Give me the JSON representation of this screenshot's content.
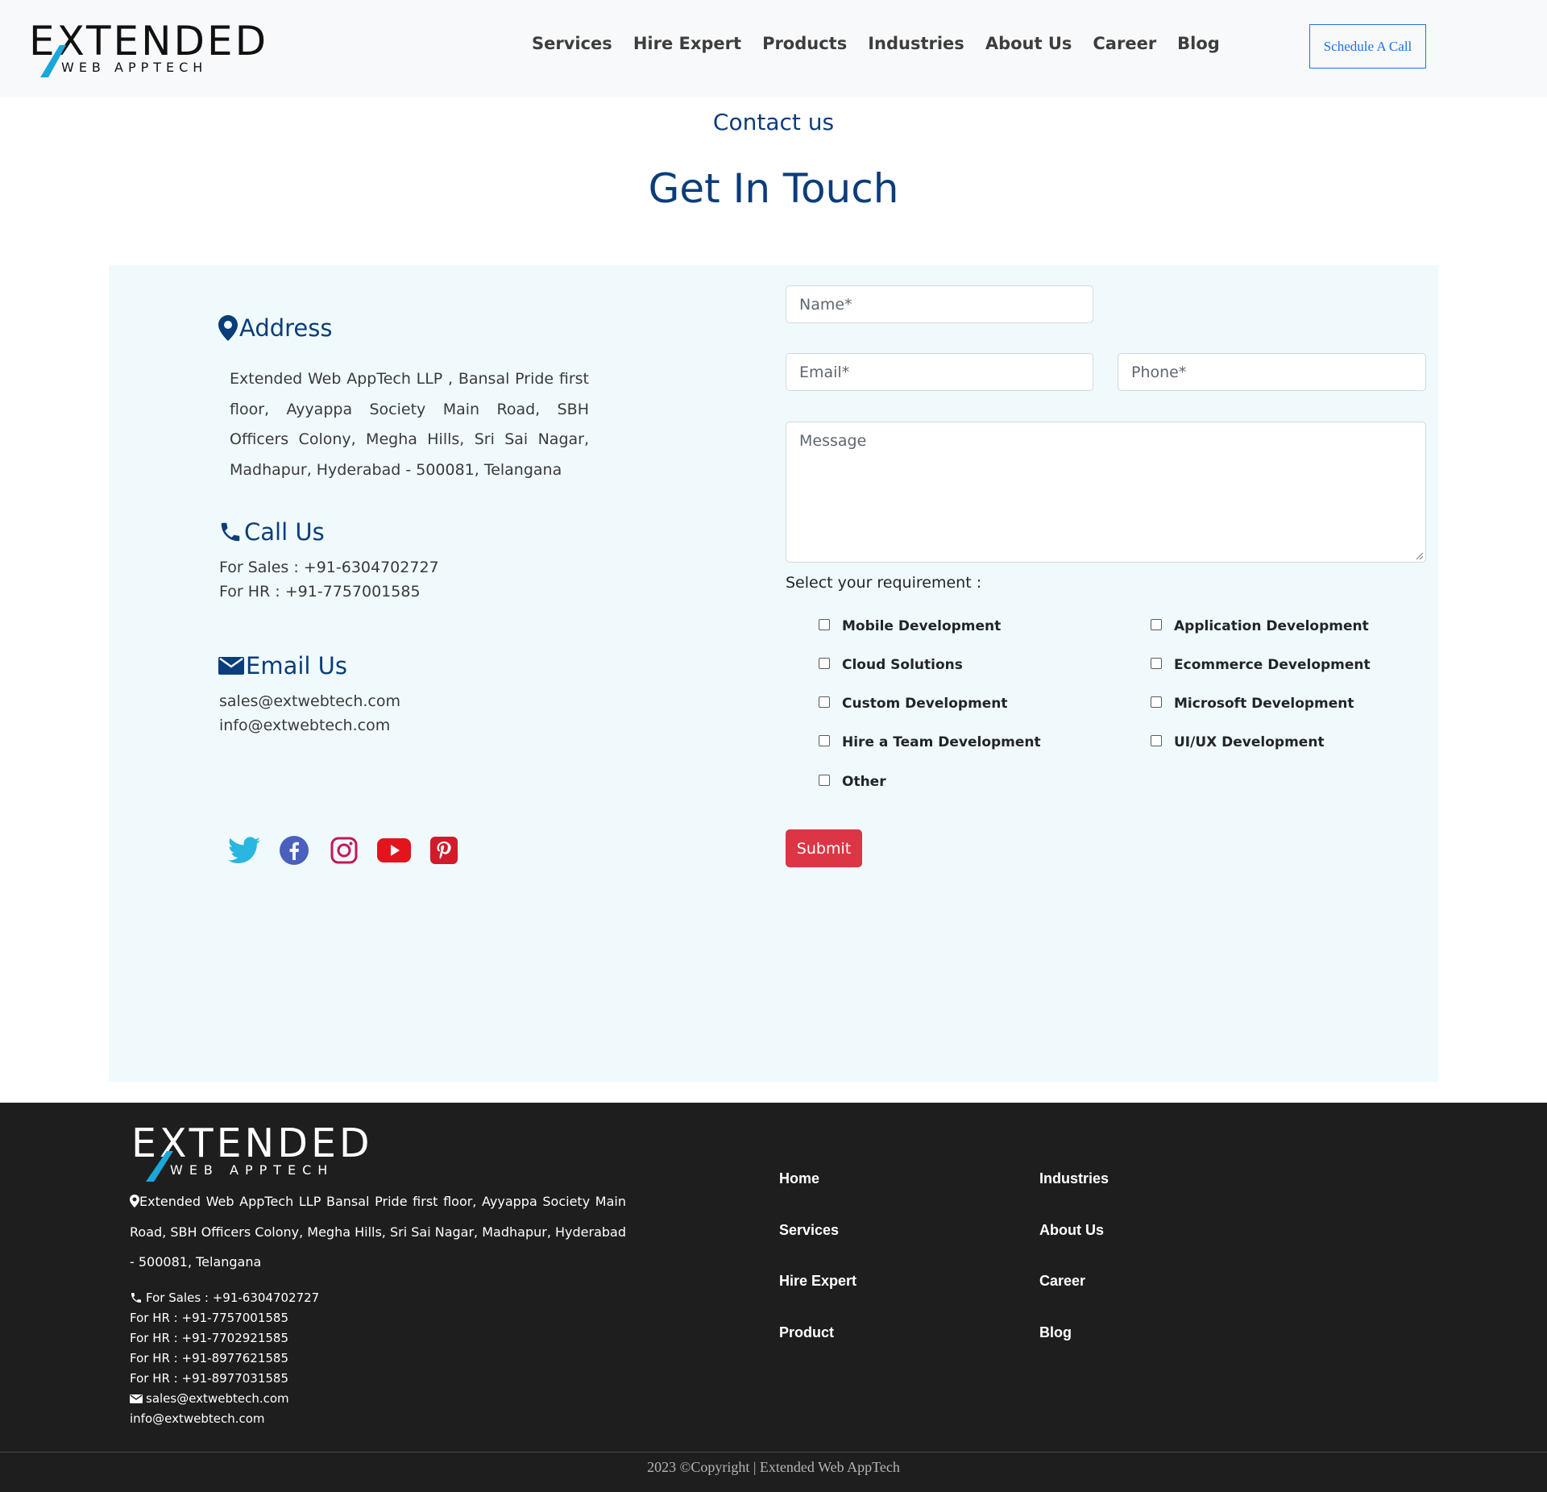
{
  "header": {
    "logo_main": "EXTENDED",
    "logo_sub": "WEB APPTECH",
    "nav": [
      "Services",
      "Hire Expert",
      "Products",
      "Industries",
      "About Us",
      "Career",
      "Blog"
    ],
    "schedule_label": "Schedule A Call"
  },
  "hero": {
    "eyebrow": "Contact us",
    "title": "Get In Touch"
  },
  "contact": {
    "address_heading": "Address",
    "address": "Extended Web AppTech LLP , Bansal Pride first floor, Ayyappa Society Main Road, SBH Officers Colony, Megha Hills, Sri Sai Nagar, Madhapur, Hyderabad - 500081, Telangana",
    "call_heading": "Call Us",
    "sales_phone": "For Sales : +91-6304702727",
    "hr_phone": "For HR : +91-7757001585",
    "email_heading": "Email Us",
    "email_sales": "sales@extwebtech.com",
    "email_info": "info@extwebtech.com",
    "social": [
      "twitter-icon",
      "facebook-icon",
      "instagram-icon",
      "youtube-icon",
      "pinterest-icon"
    ]
  },
  "form": {
    "name_placeholder": "Name*",
    "email_placeholder": "Email*",
    "phone_placeholder": "Phone*",
    "message_placeholder": "Message",
    "requirement_label": "Select your requirement :",
    "options": [
      "Mobile Development",
      "Application Development",
      "Cloud Solutions",
      "Ecommerce Development",
      "Custom Development",
      "Microsoft Development",
      "Hire a Team Development",
      "UI/UX Development",
      "Other"
    ],
    "submit_label": "Submit"
  },
  "footer": {
    "logo_main": "EXTENDED",
    "logo_sub": "WEB APPTECH",
    "address": "Extended Web AppTech LLP Bansal Pride first floor, Ayyappa Society Main Road, SBH Officers Colony, Megha Hills, Sri Sai Nagar, Madhapur, Hyderabad - 500081, Telangana",
    "sales_phone": "For Sales : +91-6304702727",
    "hr_phones": [
      "For HR : +91-7757001585",
      "For HR : +91-7702921585",
      "For HR : +91-8977621585",
      "For HR : +91-8977031585"
    ],
    "email_sales": "sales@extwebtech.com",
    "email_info": "info@extwebtech.com",
    "links_col1": [
      "Home",
      "Services",
      "Hire Expert",
      "Product"
    ],
    "links_col2": [
      "Industries",
      "About Us",
      "Career",
      "Blog"
    ],
    "copyright": "2023 ©Copyright | Extended Web AppTech"
  },
  "colors": {
    "brand_blue": "#0b3d7a",
    "accent_cyan": "#1aa7d9",
    "submit_red": "#dc3545",
    "panel_bg": "#f0fafd",
    "footer_bg": "#1e1e1e"
  }
}
